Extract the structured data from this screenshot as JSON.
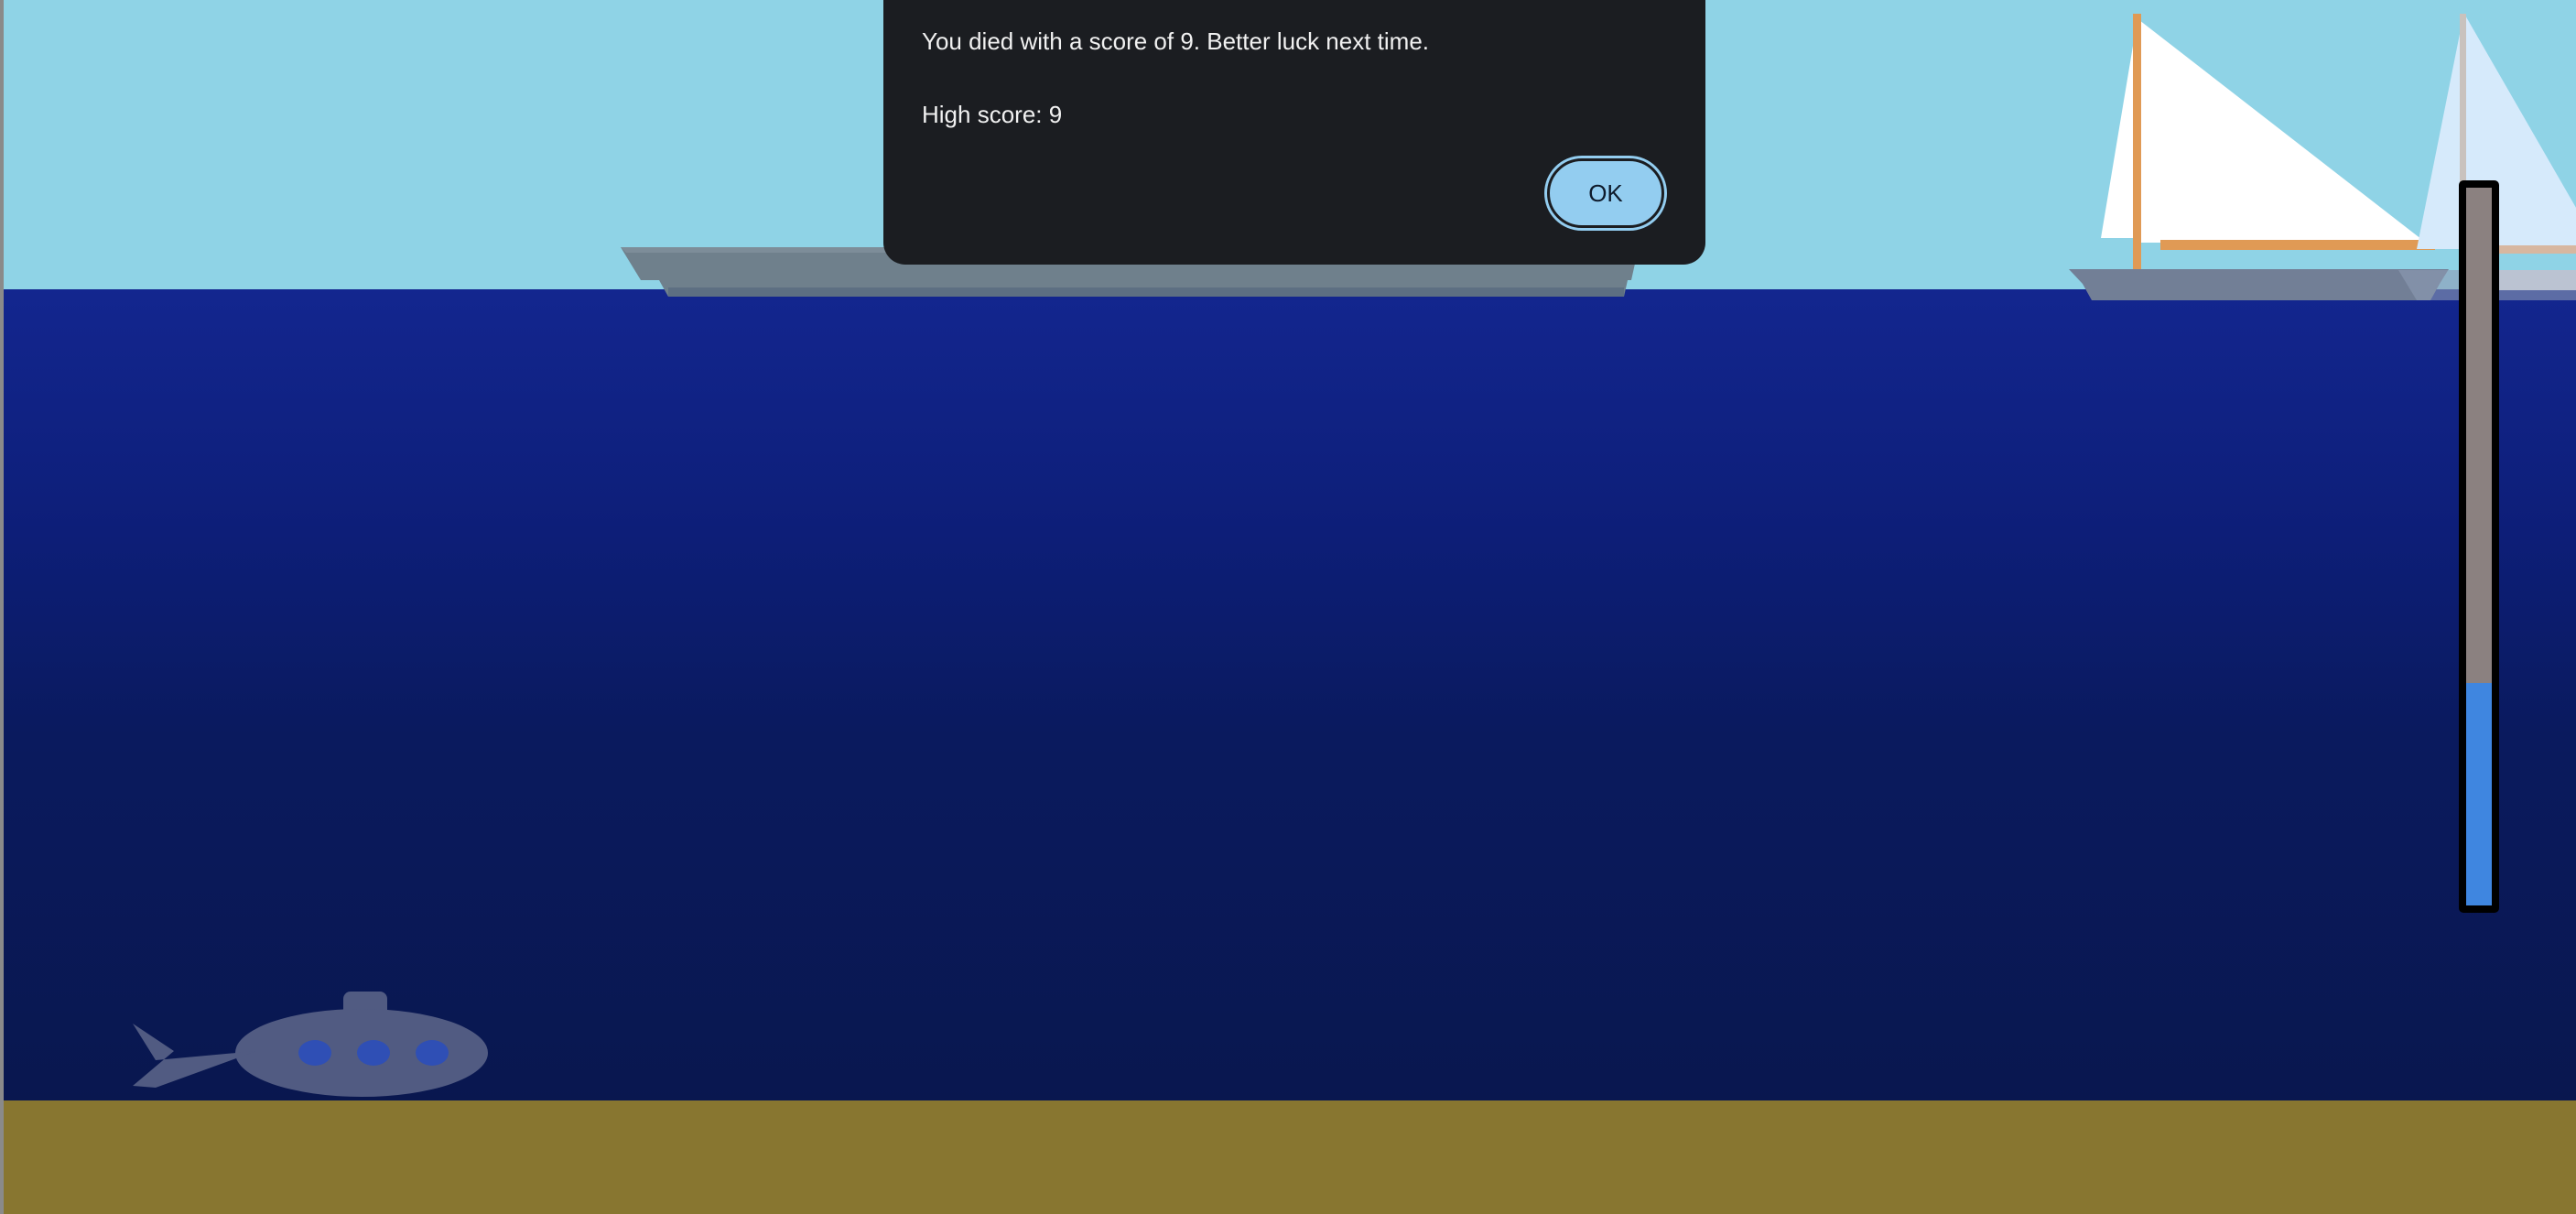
{
  "dialog": {
    "title": "",
    "message": "You died with a score of 9. Better luck next time.",
    "high_score_text": "High score: 9",
    "ok_label": "OK"
  },
  "game": {
    "score": 9,
    "high_score": 9,
    "gauge_level": 0.31
  },
  "colors": {
    "sky": "#8fd3e6",
    "ocean_top": "#13268f",
    "ocean_bottom": "#09174f",
    "seabed": "#887630",
    "gauge_fill": "#3f86e0",
    "gauge_empty": "#8b8180",
    "dialog_bg": "#1b1d21",
    "button_bg": "#93cdf0"
  },
  "sprites": {
    "player": "submarine-icon",
    "ship": "warship-icon",
    "boat": "sailboat-icon"
  }
}
